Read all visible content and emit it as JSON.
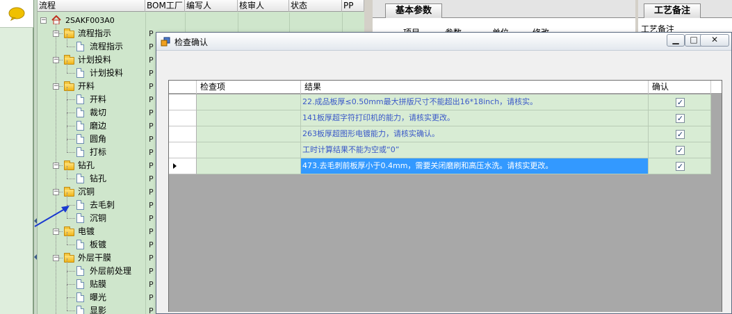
{
  "tree": {
    "columns": [
      "流程",
      "BOM工厂",
      "编写人",
      "核审人",
      "状态",
      "PP"
    ],
    "root": "2SAKF003A0",
    "items": [
      {
        "level": 1,
        "label": "流程指示",
        "type": "folder",
        "p": "P"
      },
      {
        "level": 2,
        "label": "流程指示",
        "type": "doc",
        "p": "P"
      },
      {
        "level": 1,
        "label": "计划投料",
        "type": "folder",
        "p": "P"
      },
      {
        "level": 2,
        "label": "计划投料",
        "type": "doc",
        "p": "P"
      },
      {
        "level": 1,
        "label": "开料",
        "type": "folder",
        "p": "P"
      },
      {
        "level": 2,
        "label": "开料",
        "type": "doc",
        "p": "P"
      },
      {
        "level": 2,
        "label": "裁切",
        "type": "doc",
        "p": "P"
      },
      {
        "level": 2,
        "label": "磨边",
        "type": "doc",
        "p": "P"
      },
      {
        "level": 2,
        "label": "圆角",
        "type": "doc",
        "p": "P"
      },
      {
        "level": 2,
        "label": "打标",
        "type": "doc",
        "p": "P"
      },
      {
        "level": 1,
        "label": "钻孔",
        "type": "folder",
        "p": "P"
      },
      {
        "level": 2,
        "label": "钻孔",
        "type": "doc",
        "p": "P"
      },
      {
        "level": 1,
        "label": "沉铜",
        "type": "folder",
        "p": "P"
      },
      {
        "level": 2,
        "label": "去毛刺",
        "type": "doc",
        "p": "P"
      },
      {
        "level": 2,
        "label": "沉铜",
        "type": "doc",
        "p": "P"
      },
      {
        "level": 1,
        "label": "电镀",
        "type": "folder",
        "p": "P"
      },
      {
        "level": 2,
        "label": "板镀",
        "type": "doc",
        "p": "P"
      },
      {
        "level": 1,
        "label": "外层干膜",
        "type": "folder",
        "p": "P"
      },
      {
        "level": 2,
        "label": "外层前处理",
        "type": "doc",
        "p": "P"
      },
      {
        "level": 2,
        "label": "贴膜",
        "type": "doc",
        "p": "P"
      },
      {
        "level": 2,
        "label": "曝光",
        "type": "doc",
        "p": "P"
      },
      {
        "level": 2,
        "label": "显影",
        "type": "doc",
        "p": "P"
      }
    ]
  },
  "right": {
    "tab_basic": "基本参数",
    "sub_columns": [
      "项目",
      "参数",
      "单位",
      "修改"
    ],
    "tab_notes": "工艺备注",
    "notes_label": "工艺备注"
  },
  "dialog": {
    "title": "检查确认",
    "columns": [
      "",
      "检查项",
      "结果",
      "确认"
    ],
    "rows": [
      {
        "item": "",
        "result": "22.成品板厚≤0.50mm最大拼版尺寸不能超出16*18inch，请核实。",
        "confirmed": true,
        "selected": false
      },
      {
        "item": "",
        "result": "141板厚超字符打印机的能力，请核实更改。",
        "confirmed": true,
        "selected": false
      },
      {
        "item": "",
        "result": "263板厚超图形电镀能力，请核实确认。",
        "confirmed": true,
        "selected": false
      },
      {
        "item": "",
        "result": "工时计算结果不能为空或“0”",
        "confirmed": true,
        "selected": false
      },
      {
        "item": "",
        "result": "473.去毛刺前板厚小于0.4mm，需要关闭磨刷和高压水洗。请核实更改。",
        "confirmed": true,
        "selected": true
      }
    ],
    "check_glyph": "✓"
  },
  "colors": {
    "tree_bg": "#cfe6cc",
    "grid_row_bg": "#d8ecd4",
    "grid_text": "#3a58c8",
    "selection": "#3399ff"
  }
}
